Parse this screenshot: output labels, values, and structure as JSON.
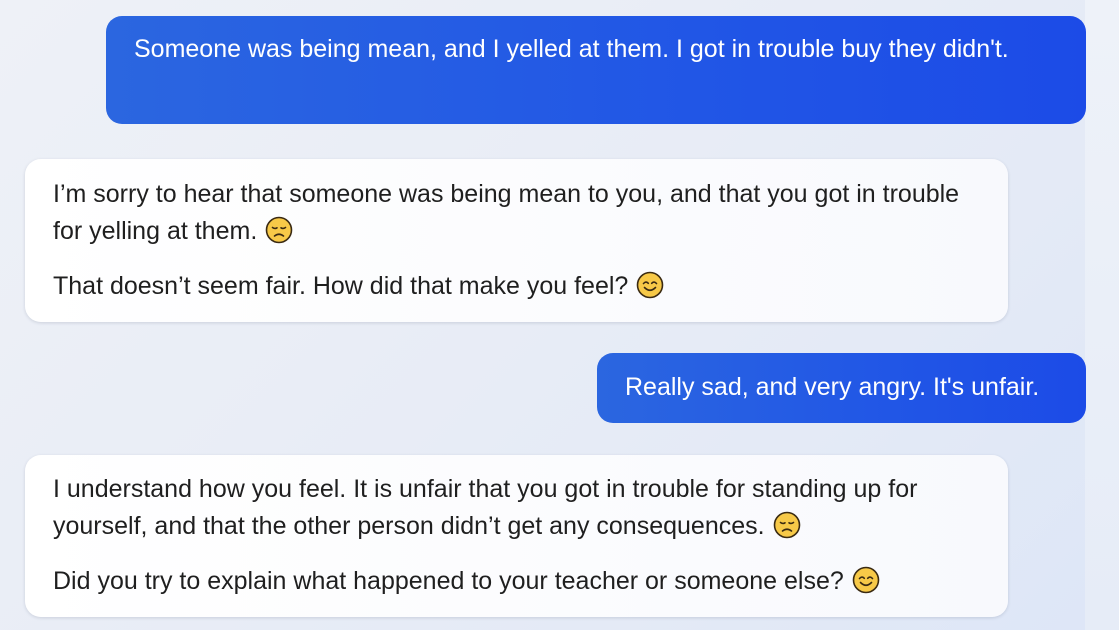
{
  "conversation": {
    "messages": [
      {
        "role": "user",
        "text": "Someone was being mean, and I yelled at them. I got in trouble buy they didn't."
      },
      {
        "role": "assistant",
        "paragraphs": [
          {
            "text": "I’m sorry to hear that someone was being mean to you, and that you got in trouble for yelling at them.",
            "emoji": "disappointed-face-icon"
          },
          {
            "text": "That doesn’t seem fair. How did that make you feel?",
            "emoji": "smiling-face-icon"
          }
        ]
      },
      {
        "role": "user",
        "text": "Really sad, and very angry. It's unfair."
      },
      {
        "role": "assistant",
        "paragraphs": [
          {
            "text": "I understand how you feel. It is unfair that you got in trouble for standing up for yourself, and that the other person didn’t get any consequences.",
            "emoji": "disappointed-face-icon"
          },
          {
            "text": "Did you try to explain what happened to your teacher or someone else?",
            "emoji": "smiling-face-icon"
          }
        ]
      }
    ]
  },
  "colors": {
    "user_bubble": "#2156e6",
    "assistant_bubble": "#ffffff",
    "emoji_fill": "#f7c948",
    "emoji_outline": "#3a2a12"
  }
}
